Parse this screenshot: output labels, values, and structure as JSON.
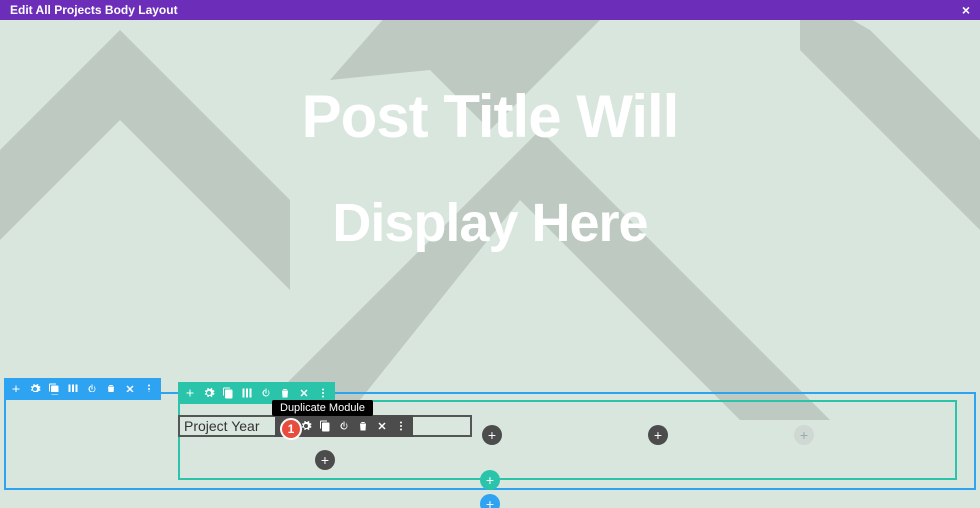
{
  "header": {
    "title": "Edit All Projects Body Layout",
    "close": "×"
  },
  "hero": {
    "line1": "Post Title Will",
    "line2": "Display Here"
  },
  "module": {
    "label": "Project Year"
  },
  "tooltip": {
    "text": "Duplicate Module"
  },
  "marker": {
    "num": "1"
  },
  "icons": {
    "plus": "+"
  }
}
